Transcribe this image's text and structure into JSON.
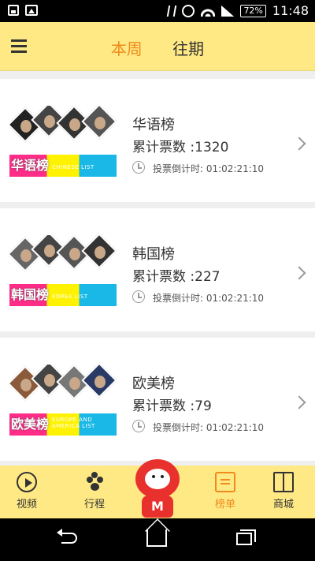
{
  "status_bar": {
    "battery": "72%",
    "time": "11:48"
  },
  "header": {
    "tabs": [
      {
        "label": "本周",
        "active": true
      },
      {
        "label": "往期",
        "active": false
      }
    ]
  },
  "lists": [
    {
      "title": "华语榜",
      "votes": "累计票数 :1320",
      "countdown": "投票倒计时: 01:02:21:10",
      "thumb_label": "华语榜",
      "thumb_sub": "CHINESE LIST"
    },
    {
      "title": "韩国榜",
      "votes": "累计票数 :227",
      "countdown": "投票倒计时: 01:02:21:10",
      "thumb_label": "韩国榜",
      "thumb_sub": "KOREA LIST"
    },
    {
      "title": "欧美榜",
      "votes": "累计票数 :79",
      "countdown": "投票倒计时: 01:02:21:10",
      "thumb_label": "欧美榜",
      "thumb_sub": "EUROPE AND AMERICA LIST"
    }
  ],
  "bottom_nav": {
    "items": [
      {
        "label": "视频",
        "icon": "play-icon"
      },
      {
        "label": "行程",
        "icon": "paw-icon"
      },
      {
        "label": "榜单",
        "icon": "scroll-icon",
        "active": true
      },
      {
        "label": "商城",
        "icon": "gift-icon"
      }
    ],
    "mascot_letter": "M"
  },
  "colors": {
    "accent": "#f08a1c",
    "header_bg": "#ffe985"
  }
}
